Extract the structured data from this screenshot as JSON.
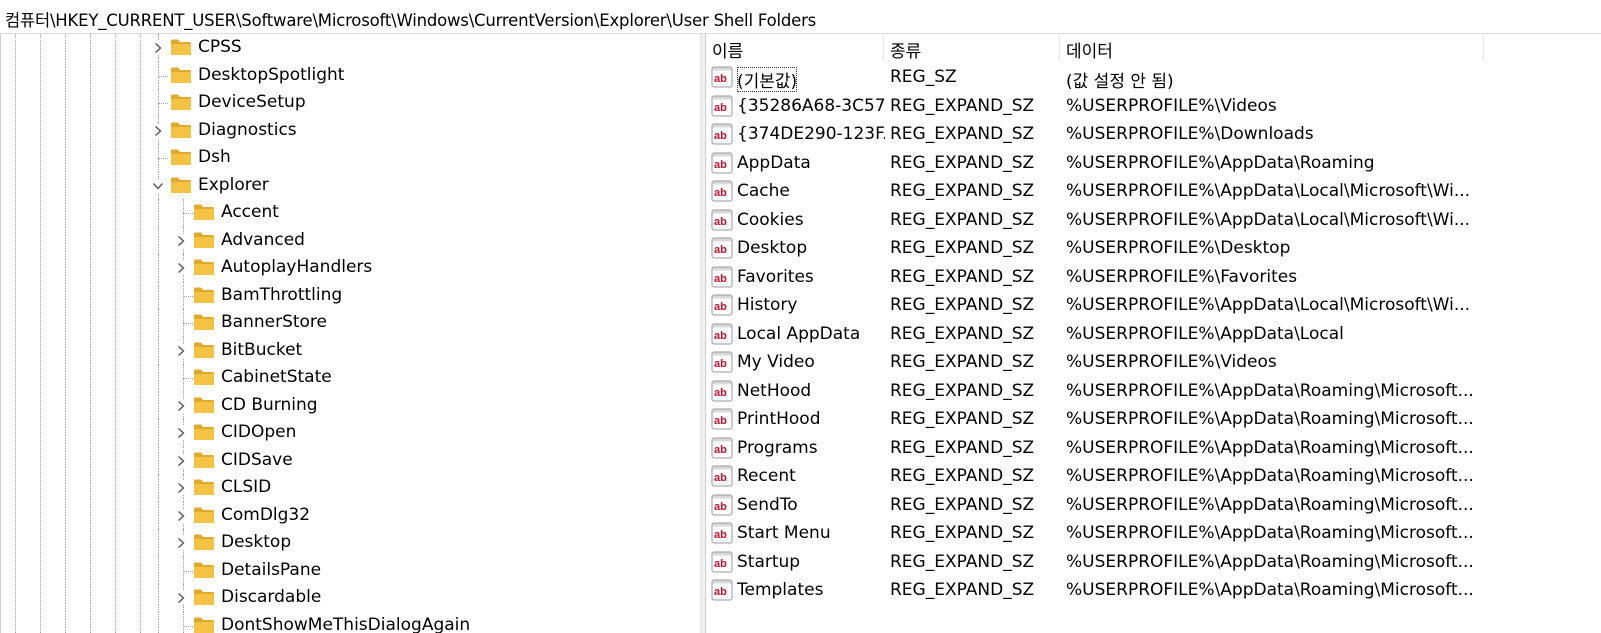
{
  "address_path": "컴퓨터\\HKEY_CURRENT_USER\\Software\\Microsoft\\Windows\\CurrentVersion\\Explorer\\User Shell Folders",
  "tree": {
    "items": [
      {
        "label": "CPSS",
        "expandable": true,
        "expanded": false,
        "level": 1
      },
      {
        "label": "DesktopSpotlight",
        "expandable": false,
        "expanded": false,
        "level": 1
      },
      {
        "label": "DeviceSetup",
        "expandable": false,
        "expanded": false,
        "level": 1
      },
      {
        "label": "Diagnostics",
        "expandable": true,
        "expanded": false,
        "level": 1
      },
      {
        "label": "Dsh",
        "expandable": false,
        "expanded": false,
        "level": 1
      },
      {
        "label": "Explorer",
        "expandable": true,
        "expanded": true,
        "level": 1
      },
      {
        "label": "Accent",
        "expandable": false,
        "expanded": false,
        "level": 2
      },
      {
        "label": "Advanced",
        "expandable": true,
        "expanded": false,
        "level": 2
      },
      {
        "label": "AutoplayHandlers",
        "expandable": true,
        "expanded": false,
        "level": 2
      },
      {
        "label": "BamThrottling",
        "expandable": false,
        "expanded": false,
        "level": 2
      },
      {
        "label": "BannerStore",
        "expandable": false,
        "expanded": false,
        "level": 2
      },
      {
        "label": "BitBucket",
        "expandable": true,
        "expanded": false,
        "level": 2
      },
      {
        "label": "CabinetState",
        "expandable": false,
        "expanded": false,
        "level": 2
      },
      {
        "label": "CD Burning",
        "expandable": true,
        "expanded": false,
        "level": 2
      },
      {
        "label": "CIDOpen",
        "expandable": true,
        "expanded": false,
        "level": 2
      },
      {
        "label": "CIDSave",
        "expandable": true,
        "expanded": false,
        "level": 2
      },
      {
        "label": "CLSID",
        "expandable": true,
        "expanded": false,
        "level": 2
      },
      {
        "label": "ComDlg32",
        "expandable": true,
        "expanded": false,
        "level": 2
      },
      {
        "label": "Desktop",
        "expandable": true,
        "expanded": false,
        "level": 2
      },
      {
        "label": "DetailsPane",
        "expandable": false,
        "expanded": false,
        "level": 2
      },
      {
        "label": "Discardable",
        "expandable": true,
        "expanded": false,
        "level": 2
      },
      {
        "label": "DontShowMeThisDialogAgain",
        "expandable": false,
        "expanded": false,
        "level": 2
      }
    ]
  },
  "list": {
    "columns": {
      "name": "이름",
      "type": "종류",
      "data": "데이터"
    },
    "rows": [
      {
        "name": "(기본값)",
        "type": "REG_SZ",
        "data": "(값 설정 안 됨)"
      },
      {
        "name": "{35286A68-3C57...",
        "type": "REG_EXPAND_SZ",
        "data": "%USERPROFILE%\\Videos"
      },
      {
        "name": "{374DE290-123F...",
        "type": "REG_EXPAND_SZ",
        "data": "%USERPROFILE%\\Downloads"
      },
      {
        "name": "AppData",
        "type": "REG_EXPAND_SZ",
        "data": "%USERPROFILE%\\AppData\\Roaming"
      },
      {
        "name": "Cache",
        "type": "REG_EXPAND_SZ",
        "data": "%USERPROFILE%\\AppData\\Local\\Microsoft\\Wi..."
      },
      {
        "name": "Cookies",
        "type": "REG_EXPAND_SZ",
        "data": "%USERPROFILE%\\AppData\\Local\\Microsoft\\Wi..."
      },
      {
        "name": "Desktop",
        "type": "REG_EXPAND_SZ",
        "data": "%USERPROFILE%\\Desktop"
      },
      {
        "name": "Favorites",
        "type": "REG_EXPAND_SZ",
        "data": "%USERPROFILE%\\Favorites"
      },
      {
        "name": "History",
        "type": "REG_EXPAND_SZ",
        "data": "%USERPROFILE%\\AppData\\Local\\Microsoft\\Wi..."
      },
      {
        "name": "Local AppData",
        "type": "REG_EXPAND_SZ",
        "data": "%USERPROFILE%\\AppData\\Local"
      },
      {
        "name": "My Video",
        "type": "REG_EXPAND_SZ",
        "data": "%USERPROFILE%\\Videos"
      },
      {
        "name": "NetHood",
        "type": "REG_EXPAND_SZ",
        "data": "%USERPROFILE%\\AppData\\Roaming\\Microsoft..."
      },
      {
        "name": "PrintHood",
        "type": "REG_EXPAND_SZ",
        "data": "%USERPROFILE%\\AppData\\Roaming\\Microsoft..."
      },
      {
        "name": "Programs",
        "type": "REG_EXPAND_SZ",
        "data": "%USERPROFILE%\\AppData\\Roaming\\Microsoft..."
      },
      {
        "name": "Recent",
        "type": "REG_EXPAND_SZ",
        "data": "%USERPROFILE%\\AppData\\Roaming\\Microsoft..."
      },
      {
        "name": "SendTo",
        "type": "REG_EXPAND_SZ",
        "data": "%USERPROFILE%\\AppData\\Roaming\\Microsoft..."
      },
      {
        "name": "Start Menu",
        "type": "REG_EXPAND_SZ",
        "data": "%USERPROFILE%\\AppData\\Roaming\\Microsoft..."
      },
      {
        "name": "Startup",
        "type": "REG_EXPAND_SZ",
        "data": "%USERPROFILE%\\AppData\\Roaming\\Microsoft..."
      },
      {
        "name": "Templates",
        "type": "REG_EXPAND_SZ",
        "data": "%USERPROFILE%\\AppData\\Roaming\\Microsoft..."
      }
    ]
  },
  "colors": {
    "folder": "#f5c343",
    "folder_dark": "#e0a92a",
    "string_icon_red": "#c8102e",
    "chevron": "#555555"
  },
  "icons": {
    "tree_folder": "folder-icon",
    "value": "string-value-icon",
    "collapsed": "chevron-right-icon",
    "expanded": "chevron-down-icon"
  }
}
